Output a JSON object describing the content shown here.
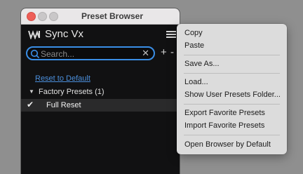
{
  "window": {
    "title": "Preset Browser"
  },
  "header": {
    "plugin_name": "Sync Vx",
    "logo_icon": "waves-logo-icon",
    "menu_icon": "hamburger-menu-icon"
  },
  "search": {
    "placeholder": "Search...",
    "value": "",
    "add_label": "+",
    "remove_label": "-"
  },
  "reset_link": "Reset to Default",
  "tree": {
    "folder": {
      "caret": "▼",
      "label": "Factory Presets (1)"
    },
    "presets": [
      {
        "check": "✔",
        "label": "Full Reset"
      }
    ]
  },
  "context_menu": {
    "items": [
      "Copy",
      "Paste",
      "Save As...",
      "Load...",
      "Show User Presets Folder...",
      "Export Favorite Presets",
      "Import Favorite Presets",
      "Open Browser by Default"
    ]
  },
  "colors": {
    "accent": "#3a8ee6",
    "link": "#4b8fdc",
    "close_button": "#ee5e57",
    "window_bg": "#111112",
    "menu_bg": "#dcdcdc"
  }
}
